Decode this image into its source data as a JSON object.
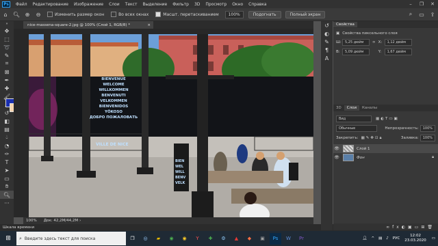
{
  "menu": {
    "logo": "Ps",
    "items": [
      "Файл",
      "Редактирование",
      "Изображение",
      "Слои",
      "Текст",
      "Выделение",
      "Фильтр",
      "3D",
      "Просмотр",
      "Окно",
      "Справка"
    ]
  },
  "options": {
    "resize_windows": "Изменить размер окон",
    "all_windows": "Во всех окнах",
    "scrubby_zoom": "Масшт. перетаскиванием",
    "zoom_value": "100%",
    "fit_button": "Подогнать",
    "fullscreen_button": "Полный экран"
  },
  "document": {
    "tab_title": "nice-massena-square-2.jpg @ 100% (Слой 1, RGB/8) *",
    "close": "×"
  },
  "image_text": {
    "welcome": [
      "BIENVENUE",
      "WELCOME",
      "WILLKOMMEN",
      "BENVENUTI",
      "VELKOMMEN",
      "BIENVENIDOS",
      "YŌKOSO",
      "ДОБРО ПОЖАЛОВАТЬ"
    ],
    "ville": "VILLE DE NICE",
    "sign_left": [
      "BIEN",
      "WEL",
      "WILL",
      "BENV",
      "VELK"
    ]
  },
  "status": {
    "zoom": "100%",
    "doc": "Док: 42,2M/44,2M"
  },
  "timeline": "Шкала времени",
  "properties": {
    "tab": "Свойства",
    "subtitle": "Свойства пиксельного слоя",
    "w_label": "Ш:",
    "w_value": "5,25 дюйм",
    "h_label": "В:",
    "h_value": "5,09 дюйм",
    "x_label": "X:",
    "x_value": "1,12 дюйм",
    "y_label": "Y:",
    "y_value": "1,67 дюйм"
  },
  "layers_panel": {
    "tabs": [
      "3D",
      "Слои",
      "Каналы"
    ],
    "kind": "Вид",
    "blend": "Обычные",
    "opacity_label": "Непрозрачность:",
    "opacity": "100%",
    "lock_label": "Закрепить:",
    "fill_label": "Заливка:",
    "fill": "100%",
    "layers": [
      {
        "name": "Слой 1",
        "selected": true
      },
      {
        "name": "Фон",
        "selected": false
      }
    ]
  },
  "taskbar": {
    "search_placeholder": "Введите здесь текст для поиска",
    "lang": "РУС",
    "time": "12:02",
    "date": "23.03.2020"
  },
  "colors": {
    "foreground": "#1a2fb0",
    "background": "#f4d4b0",
    "ps_blue": "#31a8ff"
  }
}
